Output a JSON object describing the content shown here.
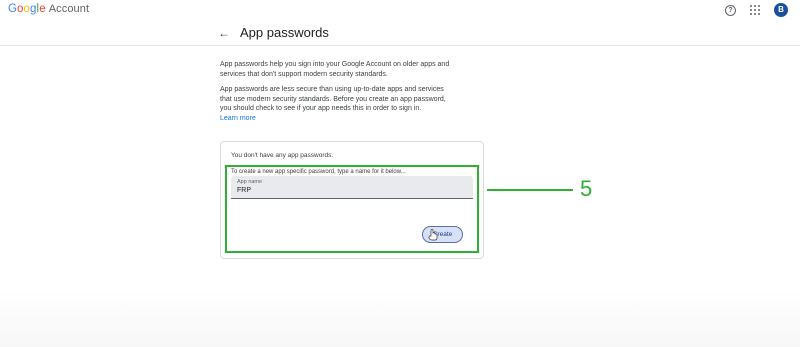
{
  "header": {
    "logo_google": "Google",
    "logo_account": "Account",
    "help_glyph": "?",
    "avatar_letter": "B"
  },
  "page": {
    "back_glyph": "←",
    "title": "App passwords"
  },
  "intro": {
    "paragraph1": "App passwords help you sign into your Google Account on older apps and services that don't support modern security standards.",
    "paragraph2": "App passwords are less secure than using up-to-date apps and services that use modern security standards. Before you create an app password, you should check to see if your app needs this in order to sign in.",
    "learn_more": "Learn more"
  },
  "card": {
    "no_passwords": "You don't have any app passwords.",
    "create_description": "To create a new app specific password, type a name for it below...",
    "field_label": "App name",
    "field_value": "FRP",
    "create_button": "Create"
  },
  "annotation": {
    "number": "5",
    "color": "#2db034"
  },
  "icons": [
    "help-icon",
    "apps-grid-icon",
    "avatar",
    "back-arrow-icon",
    "mouse-pointer-icon"
  ]
}
